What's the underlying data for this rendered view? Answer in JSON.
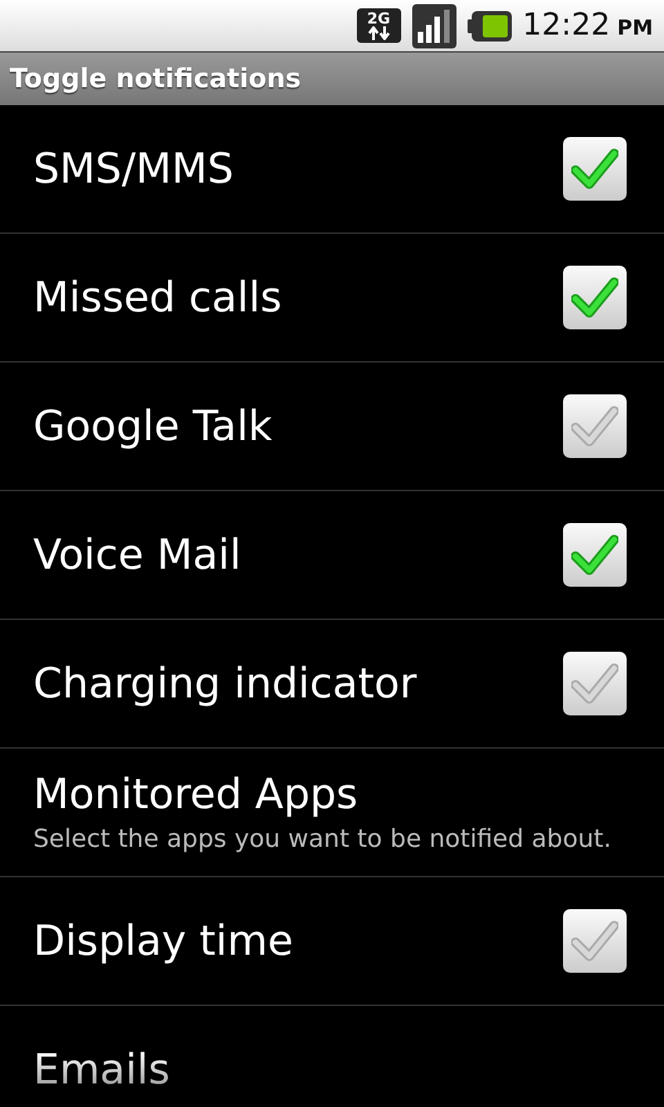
{
  "status_bar": {
    "network": "2G",
    "time": "12:22",
    "meridiem": "PM"
  },
  "title": "Toggle notifications",
  "items": [
    {
      "kind": "checkbox",
      "label": "SMS/MMS",
      "checked": true
    },
    {
      "kind": "checkbox",
      "label": "Missed calls",
      "checked": true
    },
    {
      "kind": "checkbox",
      "label": "Google Talk",
      "checked": false
    },
    {
      "kind": "checkbox",
      "label": "Voice Mail",
      "checked": true
    },
    {
      "kind": "checkbox",
      "label": "Charging indicator",
      "checked": false
    },
    {
      "kind": "link",
      "label": "Monitored Apps",
      "summary": "Select the apps you want to be notified about."
    },
    {
      "kind": "checkbox",
      "label": "Display time",
      "checked": false
    },
    {
      "kind": "link",
      "label": "Emails"
    }
  ]
}
